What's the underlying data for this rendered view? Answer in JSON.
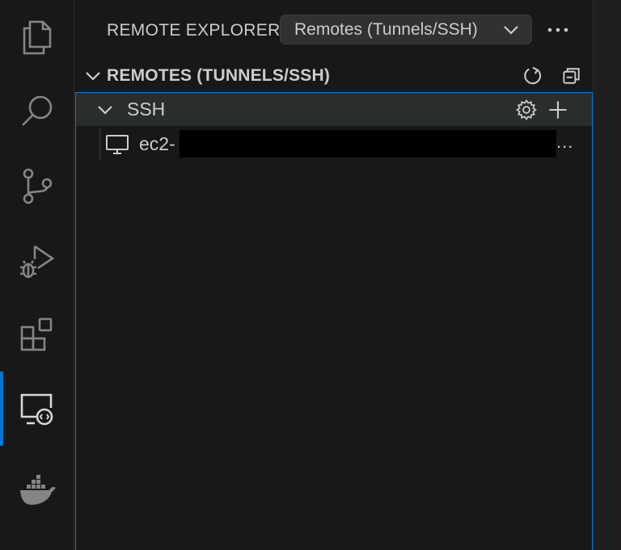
{
  "activity_bar": {
    "items": [
      {
        "name": "explorer-icon"
      },
      {
        "name": "search-icon"
      },
      {
        "name": "source-control-icon"
      },
      {
        "name": "run-debug-icon"
      },
      {
        "name": "extensions-icon"
      },
      {
        "name": "remote-explorer-icon",
        "active": true
      },
      {
        "name": "docker-icon"
      }
    ],
    "accent": "#0078d4"
  },
  "sidebar": {
    "title": "REMOTE EXPLORER",
    "dropdown_value": "Remotes (Tunnels/SSH)",
    "more_icon": "ellipsis-icon"
  },
  "section": {
    "title": "REMOTES (TUNNELS/SSH)",
    "actions": [
      "refresh-icon",
      "collapse-all-icon"
    ]
  },
  "tree": {
    "group_label": "SSH",
    "group_actions": [
      "gear-icon",
      "plus-icon"
    ],
    "hosts": [
      {
        "label": "ec2-",
        "icon": "monitor-icon",
        "trailing": "..."
      }
    ]
  },
  "colors": {
    "background": "#181818",
    "hover_row": "#2a2d2e",
    "focus_border": "#0078d4",
    "text": "#cccccc"
  }
}
